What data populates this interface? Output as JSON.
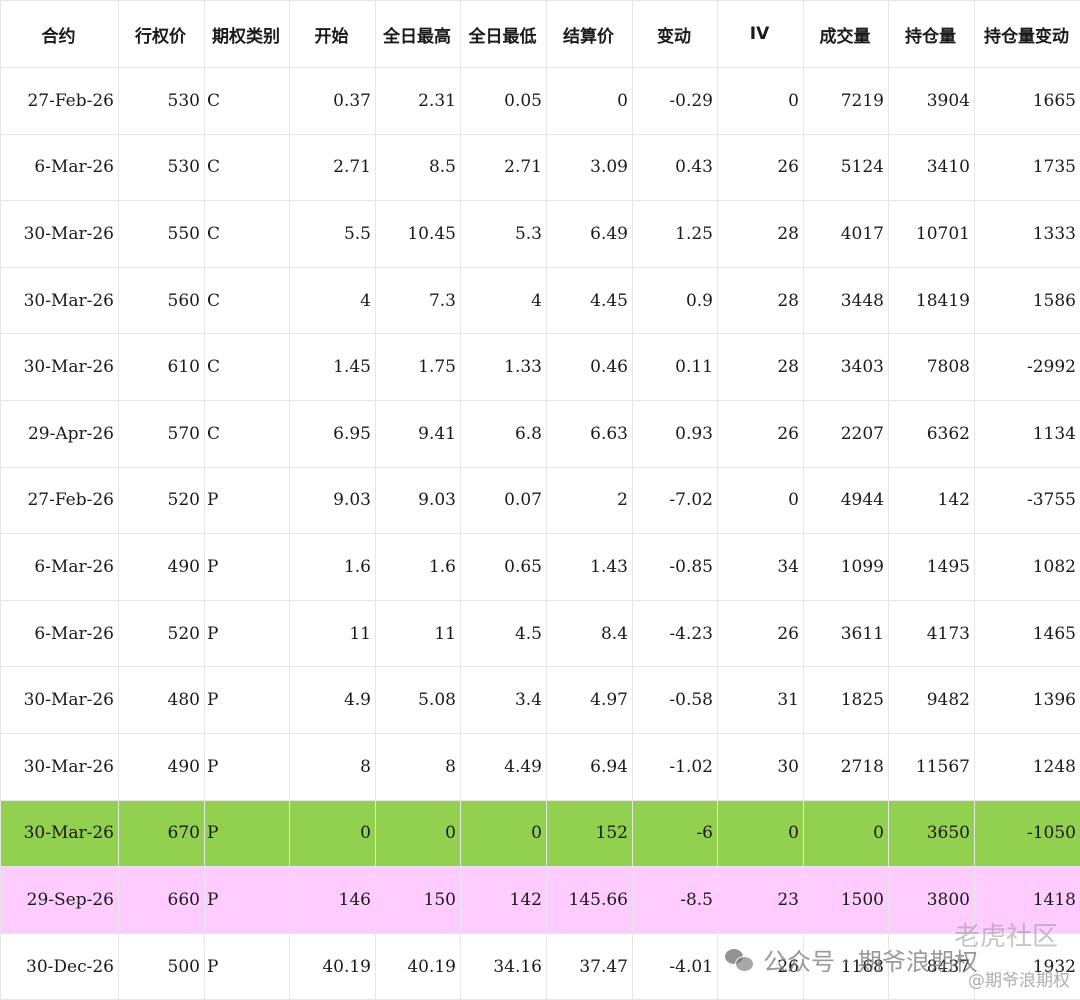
{
  "headers": [
    "合约",
    "行权价",
    "期权类别",
    "开始",
    "全日最高",
    "全日最低",
    "结算价",
    "变动",
    "IV",
    "成交量",
    "持仓量",
    "持仓量变动"
  ],
  "rows": [
    [
      "27-Feb-26",
      "530",
      "C",
      "0.37",
      "2.31",
      "0.05",
      "0",
      "-0.29",
      "0",
      "7219",
      "3904",
      "1665"
    ],
    [
      "6-Mar-26",
      "530",
      "C",
      "2.71",
      "8.5",
      "2.71",
      "3.09",
      "0.43",
      "26",
      "5124",
      "3410",
      "1735"
    ],
    [
      "30-Mar-26",
      "550",
      "C",
      "5.5",
      "10.45",
      "5.3",
      "6.49",
      "1.25",
      "28",
      "4017",
      "10701",
      "1333"
    ],
    [
      "30-Mar-26",
      "560",
      "C",
      "4",
      "7.3",
      "4",
      "4.45",
      "0.9",
      "28",
      "3448",
      "18419",
      "1586"
    ],
    [
      "30-Mar-26",
      "610",
      "C",
      "1.45",
      "1.75",
      "1.33",
      "0.46",
      "0.11",
      "28",
      "3403",
      "7808",
      "-2992"
    ],
    [
      "29-Apr-26",
      "570",
      "C",
      "6.95",
      "9.41",
      "6.8",
      "6.63",
      "0.93",
      "26",
      "2207",
      "6362",
      "1134"
    ],
    [
      "27-Feb-26",
      "520",
      "P",
      "9.03",
      "9.03",
      "0.07",
      "2",
      "-7.02",
      "0",
      "4944",
      "142",
      "-3755"
    ],
    [
      "6-Mar-26",
      "490",
      "P",
      "1.6",
      "1.6",
      "0.65",
      "1.43",
      "-0.85",
      "34",
      "1099",
      "1495",
      "1082"
    ],
    [
      "6-Mar-26",
      "520",
      "P",
      "11",
      "11",
      "4.5",
      "8.4",
      "-4.23",
      "26",
      "3611",
      "4173",
      "1465"
    ],
    [
      "30-Mar-26",
      "480",
      "P",
      "4.9",
      "5.08",
      "3.4",
      "4.97",
      "-0.58",
      "31",
      "1825",
      "9482",
      "1396"
    ],
    [
      "30-Mar-26",
      "490",
      "P",
      "8",
      "8",
      "4.49",
      "6.94",
      "-1.02",
      "30",
      "2718",
      "11567",
      "1248"
    ],
    [
      "30-Mar-26",
      "670",
      "P",
      "0",
      "0",
      "0",
      "152",
      "-6",
      "0",
      "0",
      "3650",
      "-1050"
    ],
    [
      "29-Sep-26",
      "660",
      "P",
      "146",
      "150",
      "142",
      "145.66",
      "-8.5",
      "23",
      "1500",
      "3800",
      "1418"
    ],
    [
      "30-Dec-26",
      "500",
      "P",
      "40.19",
      "40.19",
      "34.16",
      "37.47",
      "-4.01",
      "26",
      "1168",
      "8437",
      "1932"
    ]
  ],
  "highlight_colors": {
    "green_row": "#92d050",
    "pink_row": "#ffccff"
  },
  "watermark": {
    "account_text": "公众号 · 期爷浪期权",
    "community_text": "老虎社区",
    "handle_text": "@期爷浪期权",
    "icon": "wechat-icon"
  }
}
